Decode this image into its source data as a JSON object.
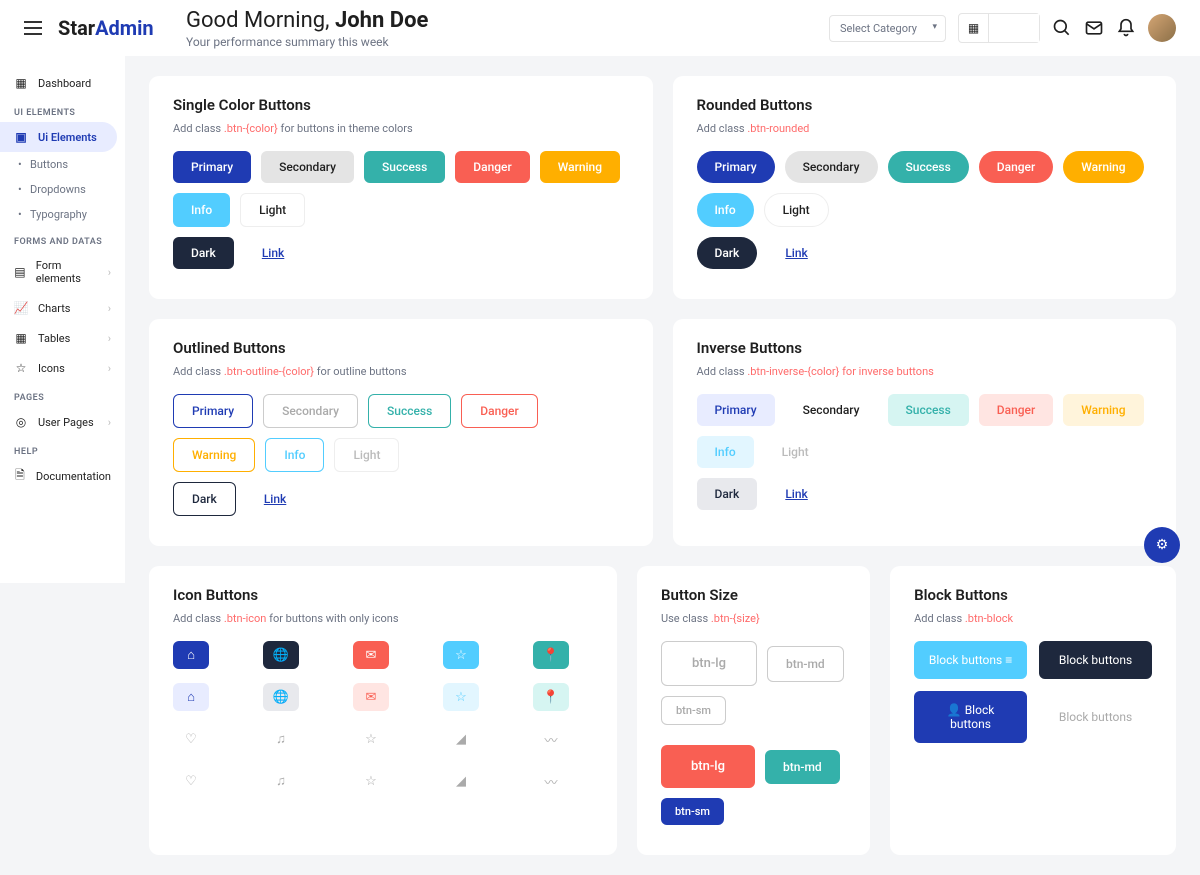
{
  "brand": {
    "part1": "Star",
    "part2": "Admin"
  },
  "greeting": {
    "pre": "Good Morning, ",
    "name": "John Doe",
    "sub": "Your performance summary this week"
  },
  "topbar": {
    "select": "Select Category"
  },
  "sidebar": {
    "dashboard": "Dashboard",
    "sec_ui": "UI ELEMENTS",
    "ui_elements": "Ui Elements",
    "buttons": "Buttons",
    "dropdowns": "Dropdowns",
    "typography": "Typography",
    "sec_forms": "FORMS AND DATAS",
    "form_elements": "Form elements",
    "charts": "Charts",
    "tables": "Tables",
    "icons": "Icons",
    "sec_pages": "PAGES",
    "user_pages": "User Pages",
    "sec_help": "HELP",
    "documentation": "Documentation"
  },
  "labels": {
    "primary": "Primary",
    "secondary": "Secondary",
    "success": "Success",
    "danger": "Danger",
    "warning": "Warning",
    "info": "Info",
    "light": "Light",
    "dark": "Dark",
    "link": "Link"
  },
  "single": {
    "title": "Single Color Buttons",
    "sub1": "Add class ",
    "code": ".btn-{color}",
    "sub2": " for buttons in theme colors"
  },
  "roundedCard": {
    "title": "Rounded Buttons",
    "sub1": "Add class ",
    "code": ".btn-rounded"
  },
  "outlined": {
    "title": "Outlined Buttons",
    "sub1": "Add class ",
    "code": ".btn-outline-{color}",
    "sub2": " for outline buttons"
  },
  "inverse": {
    "title": "Inverse Buttons",
    "sub1": "Add class ",
    "code": ".btn-inverse-{color} for inverse buttons"
  },
  "iconCard": {
    "title": "Icon Buttons",
    "sub1": "Add class ",
    "code": ".btn-icon",
    "sub2": " for buttons with only icons"
  },
  "sizeCard": {
    "title": "Button Size",
    "sub1": "Use class ",
    "code": ".btn-{size}",
    "lg": "btn-lg",
    "md": "btn-md",
    "sm": "btn-sm"
  },
  "blockCard": {
    "title": "Block Buttons",
    "sub1": "Add class ",
    "code": ".btn-block",
    "label": "Block buttons"
  }
}
